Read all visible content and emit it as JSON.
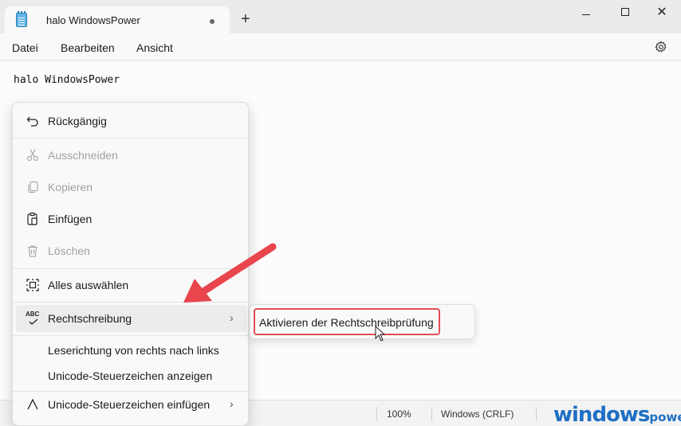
{
  "window": {
    "tab_title": "halo WindowsPower",
    "new_tab_symbol": "+",
    "close_symbol": "✕"
  },
  "menubar": {
    "items": [
      "Datei",
      "Bearbeiten",
      "Ansicht"
    ]
  },
  "editor": {
    "text": "halo WindowsPower"
  },
  "context_menu": {
    "items": [
      {
        "label": "Rückgängig",
        "icon": "undo-icon",
        "enabled": true
      },
      {
        "label": "Ausschneiden",
        "icon": "cut-icon",
        "enabled": false
      },
      {
        "label": "Kopieren",
        "icon": "copy-icon",
        "enabled": false
      },
      {
        "label": "Einfügen",
        "icon": "paste-icon",
        "enabled": true
      },
      {
        "label": "Löschen",
        "icon": "delete-icon",
        "enabled": false
      },
      {
        "label": "Alles auswählen",
        "icon": "select-all-icon",
        "enabled": true
      },
      {
        "label": "Rechtschreibung",
        "icon": "spellcheck-icon",
        "icon_text": "ABC",
        "enabled": true,
        "submenu": true
      },
      {
        "label": "Leserichtung von rechts nach links",
        "enabled": true
      },
      {
        "label": "Unicode-Steuerzeichen anzeigen",
        "enabled": true
      },
      {
        "label": "Unicode-Steuerzeichen einfügen",
        "icon": "unicode-insert-icon",
        "enabled": true,
        "submenu": true
      }
    ],
    "chevron": "›"
  },
  "submenu": {
    "item_label": "Aktivieren der Rechtschreibprüfung"
  },
  "statusbar": {
    "zoom": "100%",
    "line_ending": "Windows (CRLF)"
  },
  "watermark": {
    "brand": "windows",
    "suffix": "power."
  },
  "colors": {
    "highlight_border": "#e04e55",
    "arrow": "#e8454d",
    "watermark": "#1f6fc4"
  }
}
